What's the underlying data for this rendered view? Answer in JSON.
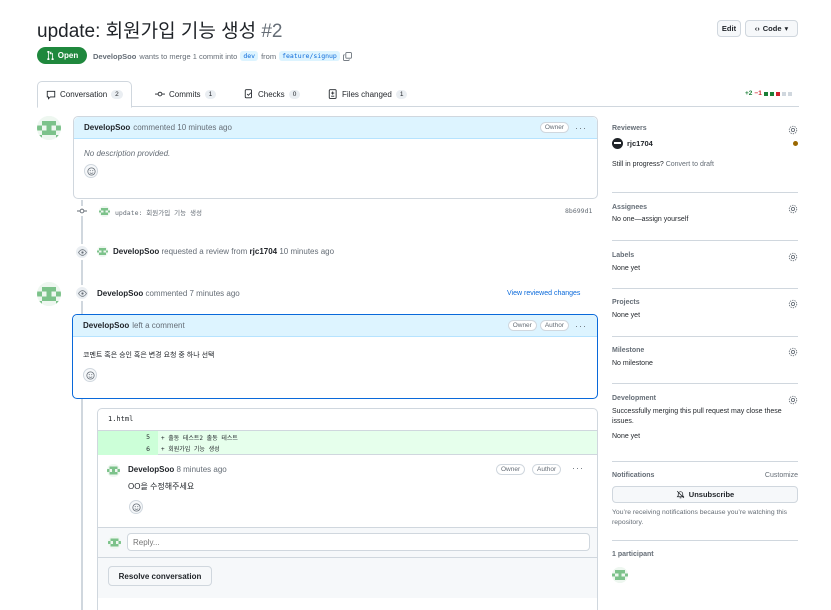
{
  "pr": {
    "title": "update: 회원가입 기능 생성",
    "number": "#2",
    "edit_label": "Edit",
    "code_label": "Code",
    "status": "Open",
    "author": "DevelopSoo",
    "merge_text": "wants to merge 1 commit into",
    "base_branch": "dev",
    "from_text": "from",
    "head_branch": "feature/signup"
  },
  "tabs": [
    {
      "label": "Conversation",
      "count": "2"
    },
    {
      "label": "Commits",
      "count": "1"
    },
    {
      "label": "Checks",
      "count": "0"
    },
    {
      "label": "Files changed",
      "count": "1"
    }
  ],
  "diffstat": {
    "additions": "+2",
    "deletions": "−1"
  },
  "first_comment": {
    "author": "DevelopSoo",
    "meta": "commented 10 minutes ago",
    "role": "Owner",
    "body": "No description provided."
  },
  "commit": {
    "message": "update: 회원가입 기능 생성",
    "sha": "8b699d1"
  },
  "review_request": {
    "author": "DevelopSoo",
    "text": "requested a review from",
    "reviewer": "rjc1704",
    "time": "10 minutes ago"
  },
  "review": {
    "author": "DevelopSoo",
    "meta": "commented 7 minutes ago",
    "view_link": "View reviewed changes"
  },
  "review_comment": {
    "author": "DevelopSoo",
    "meta": "left a comment",
    "roles": [
      "Owner",
      "Author"
    ],
    "body": "코멘트 혹은 승인 혹은 변경 요청 중 하나 선택"
  },
  "diff": {
    "filename": "1.html",
    "lines": [
      {
        "num": "5",
        "text": "+ 출동 테스트2 출동 테스트"
      },
      {
        "num": "6",
        "text": "+ 회원가입 기능 생성"
      }
    ]
  },
  "thread_comment": {
    "author": "DevelopSoo",
    "meta": "8 minutes ago",
    "roles": [
      "Owner",
      "Author"
    ],
    "body": "OO을 수정해주세요"
  },
  "reply_placeholder": "Reply...",
  "resolve_label": "Resolve conversation",
  "sidebar": {
    "reviewers": {
      "title": "Reviewers",
      "user": "rjc1704",
      "draft_text": "Still in progress?",
      "draft_link": "Convert to draft"
    },
    "assignees": {
      "title": "Assignees",
      "text": "No one—assign yourself"
    },
    "labels": {
      "title": "Labels",
      "text": "None yet"
    },
    "projects": {
      "title": "Projects",
      "text": "None yet"
    },
    "milestone": {
      "title": "Milestone",
      "text": "No milestone"
    },
    "development": {
      "title": "Development",
      "text": "Successfully merging this pull request may close these issues.",
      "text2": "None yet"
    },
    "notifications": {
      "title": "Notifications",
      "customize": "Customize",
      "button": "Unsubscribe",
      "text": "You’re receiving notifications because you’re watching this repository."
    },
    "participants": {
      "title": "1 participant"
    }
  },
  "colors": {
    "green": "#1f883d",
    "blue": "#0969da",
    "red": "#cf222e",
    "pending": "#9a6700"
  }
}
